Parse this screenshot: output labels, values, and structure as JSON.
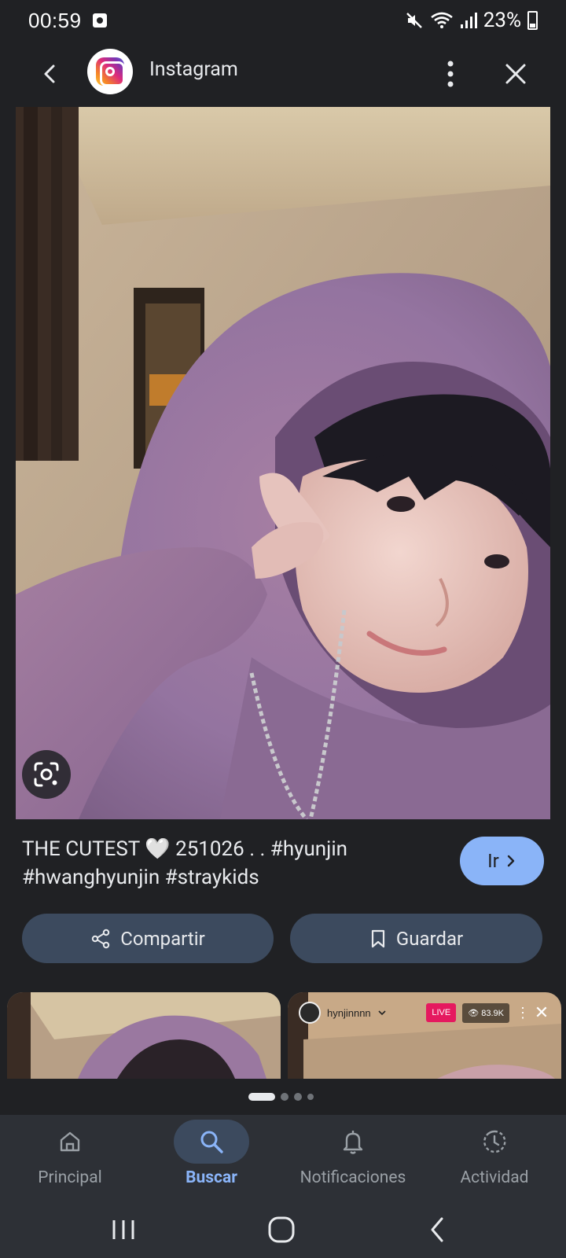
{
  "status_bar": {
    "time": "00:59",
    "battery": "23%"
  },
  "header": {
    "site_name": "Instagram"
  },
  "caption": {
    "text": "THE CUTEST 🤍 251026 . . #hyunjin #hwanghyunjin #straykids"
  },
  "buttons": {
    "go_label": "Ir",
    "share_label": "Compartir",
    "save_label": "Guardar"
  },
  "related": {
    "card_2_user": "hynjinnnn",
    "card_2_live": "LIVE",
    "card_2_viewers": "83.9K"
  },
  "bottom_nav": {
    "items": [
      {
        "label": "Principal"
      },
      {
        "label": "Buscar"
      },
      {
        "label": "Notificaciones"
      },
      {
        "label": "Actividad"
      }
    ],
    "active_index": 1
  },
  "colors": {
    "background": "#202124",
    "accent": "#8ab4f8",
    "button_bg": "#3c4a5e"
  }
}
